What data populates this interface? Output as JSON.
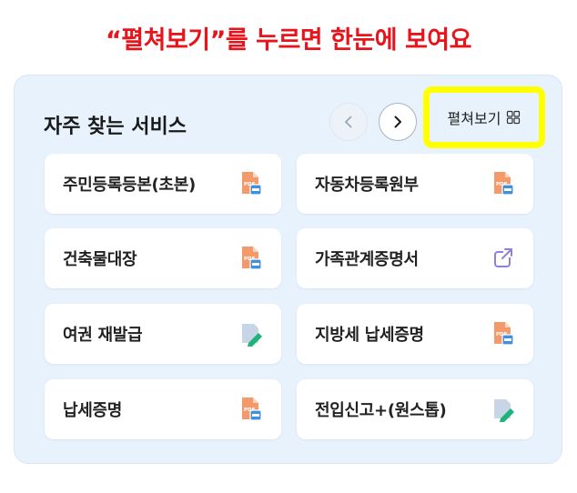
{
  "banner": {
    "text": "“펼쳐보기”를 누르면 한눈에 보여요"
  },
  "section": {
    "title": "자주 찾는 서비스",
    "expand_label": "펼쳐보기"
  },
  "colors": {
    "banner": "#e8141b",
    "highlight": "#ffff00",
    "panel_bg": "#e8f2fc"
  },
  "services": [
    {
      "label": "주민등록등본(초본)",
      "icon": "pdf-file-icon"
    },
    {
      "label": "자동차등록원부",
      "icon": "pdf-file-icon"
    },
    {
      "label": "건축물대장",
      "icon": "pdf-file-icon"
    },
    {
      "label": "가족관계증명서",
      "icon": "external-link-icon"
    },
    {
      "label": "여권 재발급",
      "icon": "edit-document-icon"
    },
    {
      "label": "지방세 납세증명",
      "icon": "pdf-file-icon"
    },
    {
      "label": "납세증명",
      "icon": "pdf-file-icon"
    },
    {
      "label": "전입신고+(원스톱)",
      "icon": "edit-document-icon"
    }
  ]
}
